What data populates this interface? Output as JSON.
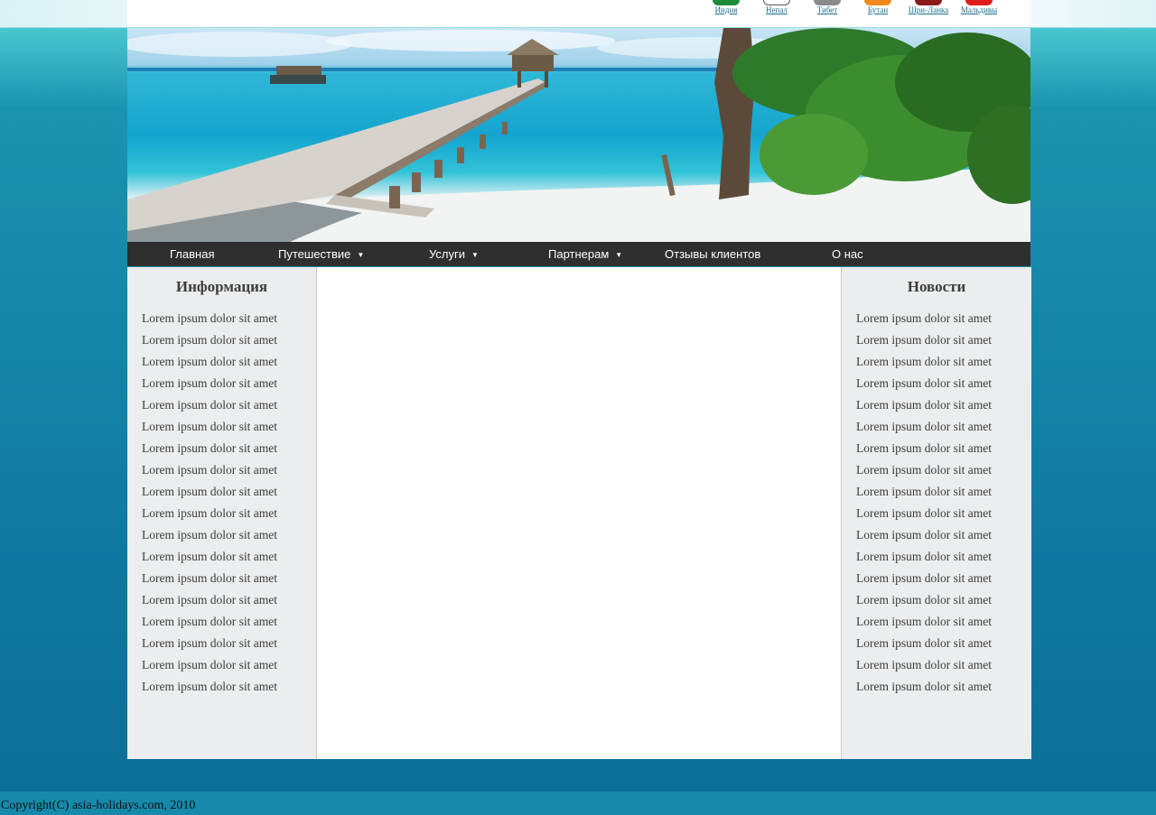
{
  "countries": [
    "Индия",
    "Непал",
    "Тибет",
    "Бутан",
    "Шри-Ланка",
    "Мальдивы"
  ],
  "nav": {
    "items": [
      {
        "label": "Главная",
        "dropdown": false
      },
      {
        "label": "Путешествие",
        "dropdown": true
      },
      {
        "label": "Услуги",
        "dropdown": true
      },
      {
        "label": "Партнерам",
        "dropdown": true
      },
      {
        "label": "Отзывы клиентов",
        "dropdown": false
      },
      {
        "label": "О нас",
        "dropdown": false
      }
    ],
    "arrow": "▼"
  },
  "left": {
    "title": "Информация",
    "items": [
      "Lorem ipsum dolor sit amet",
      "Lorem ipsum dolor sit amet",
      "Lorem ipsum dolor sit amet",
      "Lorem ipsum dolor sit amet",
      "Lorem ipsum dolor sit amet",
      "Lorem ipsum dolor sit amet",
      "Lorem ipsum dolor sit amet",
      "Lorem ipsum dolor sit amet",
      "Lorem ipsum dolor sit amet",
      "Lorem ipsum dolor sit amet",
      "Lorem ipsum dolor sit amet",
      "Lorem ipsum dolor sit amet",
      "Lorem ipsum dolor sit amet",
      "Lorem ipsum dolor sit amet",
      "Lorem ipsum dolor sit amet",
      "Lorem ipsum dolor sit amet",
      "Lorem ipsum dolor sit amet",
      "Lorem ipsum dolor sit amet"
    ]
  },
  "right": {
    "title": "Новости",
    "items": [
      "Lorem ipsum dolor sit amet",
      "Lorem ipsum dolor sit amet",
      "Lorem ipsum dolor sit amet",
      "Lorem ipsum dolor sit amet",
      "Lorem ipsum dolor sit amet",
      "Lorem ipsum dolor sit amet",
      "Lorem ipsum dolor sit amet",
      "Lorem ipsum dolor sit amet",
      "Lorem ipsum dolor sit amet",
      "Lorem ipsum dolor sit amet",
      "Lorem ipsum dolor sit amet",
      "Lorem ipsum dolor sit amet",
      "Lorem ipsum dolor sit amet",
      "Lorem ipsum dolor sit amet",
      "Lorem ipsum dolor sit amet",
      "Lorem ipsum dolor sit amet",
      "Lorem ipsum dolor sit amet",
      "Lorem ipsum dolor sit amet"
    ]
  },
  "footer": {
    "copyright": "Copyright(C) asia-holidays.com, 2010"
  }
}
